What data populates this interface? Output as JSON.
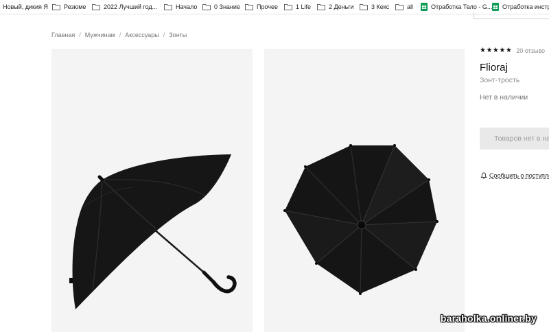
{
  "bookmarks": [
    {
      "label": "Новый, дикия Я",
      "icon": "partial-icon"
    },
    {
      "label": "Резюме",
      "icon": "folder-icon"
    },
    {
      "label": "2022 Лучший год...",
      "icon": "folder-icon"
    },
    {
      "label": "Начало",
      "icon": "folder-icon"
    },
    {
      "label": "0 Знание",
      "icon": "folder-icon"
    },
    {
      "label": "Прочее",
      "icon": "folder-icon"
    },
    {
      "label": "1 Life",
      "icon": "folder-icon"
    },
    {
      "label": "2 Деньги",
      "icon": "folder-icon"
    },
    {
      "label": "3 Кекс",
      "icon": "folder-icon"
    },
    {
      "label": "all",
      "icon": "folder-icon"
    },
    {
      "label": "Отработка Тело - G...",
      "icon": "google-sheets-icon"
    },
    {
      "label": "Отработка инстру",
      "icon": "google-sheets-icon"
    }
  ],
  "breadcrumb": {
    "items": [
      "Главная",
      "Мужчинам",
      "Аксессуары",
      "Зонты"
    ],
    "separator": "/"
  },
  "product": {
    "rating": {
      "stars": 5,
      "stars_text": "★★★★★",
      "reviews_label": "20 отзыво"
    },
    "brand": "Flioraj",
    "type": "Зонт-трость",
    "stock_status": "Нет в наличии",
    "unavailable_button": "Товаров нет в на",
    "notify_label": "Сообщить о поступле"
  },
  "watermark": "baraholka.onliner.by",
  "colors": {
    "folder": "#5f6368",
    "sheets_green": "#0f9d58",
    "photo_bg": "#f4f4f4",
    "button_bg": "#e9e9e9",
    "canopy": "#141414"
  }
}
